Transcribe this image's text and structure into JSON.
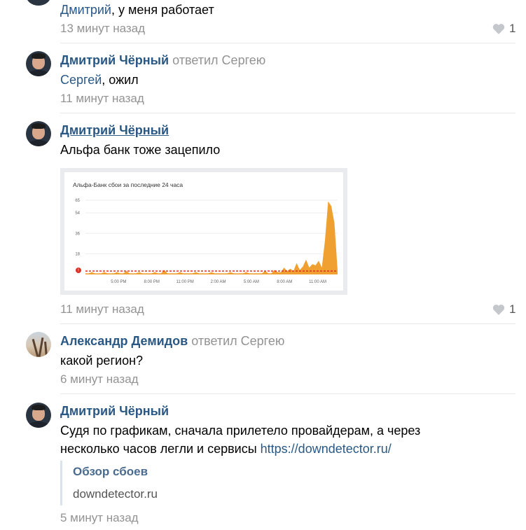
{
  "comments": [
    {
      "mention": "Дмитрий",
      "text": ", у меня работает",
      "time": "13 минут назад",
      "likes": "1"
    },
    {
      "author": "Дмитрий Чёрный",
      "reply_to": "ответил Сергею",
      "mention": "Сергей",
      "text": ", ожил",
      "time": "11 минут назад"
    },
    {
      "author": "Дмитрий Чёрный",
      "text": "Альфа банк тоже зацепило",
      "time": "11 минут назад",
      "likes": "1"
    },
    {
      "author": "Александр Демидов",
      "reply_to": "ответил Сергею",
      "text": "какой регион?",
      "time": "6 минут назад"
    },
    {
      "author": "Дмитрий Чёрный",
      "text_line1": "Судя по графикам, сначала прилетело провайдерам, а через",
      "text_line2": "несколько часов легли и сервисы ",
      "link": "https://downdetector.ru/",
      "snippet_title": "Обзор сбоев",
      "snippet_domain": "downdetector.ru",
      "time": "5 минут назад"
    }
  ],
  "chart_data": {
    "type": "area",
    "title": "Альфа-Банк сбои за последние 24 часа",
    "yticks": [
      65,
      54,
      36,
      18
    ],
    "xticks": [
      "5:00 PM",
      "8:00 PM",
      "11:00 PM",
      "2:00 AM",
      "5:00 AM",
      "8:00 AM",
      "11:00 AM"
    ],
    "ylim": [
      0,
      65
    ],
    "baseline": 3,
    "baseline_label": "!",
    "series_color": "#f0a030",
    "baseline_color": "#d93025",
    "x": [
      0,
      1,
      2,
      3,
      4,
      5,
      6,
      7,
      8,
      9,
      10,
      11,
      12,
      13,
      14,
      15,
      16,
      17,
      18,
      19,
      20,
      21,
      22,
      23,
      24,
      25,
      26,
      27,
      28,
      29,
      30,
      31,
      32,
      33,
      34,
      35,
      36,
      37,
      38,
      39,
      40,
      41,
      42,
      43,
      44,
      45,
      46,
      47,
      48,
      49,
      50,
      51,
      52,
      53,
      54,
      55,
      56,
      57,
      58,
      59,
      60,
      61,
      62,
      63,
      64,
      65,
      66,
      67,
      68,
      69,
      70,
      71,
      72,
      73,
      74,
      75,
      76,
      77,
      78,
      79,
      80
    ],
    "values": [
      1,
      1,
      2,
      1,
      1,
      1,
      2,
      1,
      1,
      1,
      2,
      1,
      1,
      3,
      1,
      1,
      1,
      2,
      1,
      1,
      1,
      1,
      2,
      1,
      1,
      4,
      1,
      1,
      1,
      1,
      2,
      1,
      1,
      1,
      1,
      2,
      1,
      1,
      1,
      1,
      2,
      1,
      1,
      1,
      1,
      1,
      2,
      1,
      1,
      1,
      1,
      2,
      1,
      1,
      1,
      1,
      1,
      3,
      1,
      1,
      4,
      2,
      2,
      6,
      3,
      5,
      3,
      10,
      4,
      7,
      13,
      6,
      9,
      8,
      12,
      6,
      30,
      64,
      60,
      45,
      3
    ]
  }
}
